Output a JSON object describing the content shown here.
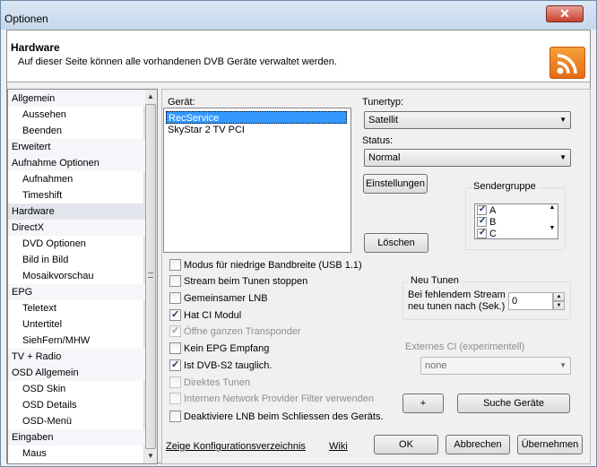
{
  "window": {
    "title": "Optionen",
    "close_label": "✕"
  },
  "header": {
    "title": "Hardware",
    "description": "Auf dieser Seite können alle vorhandenen DVB Geräte verwaltet werden."
  },
  "tree": {
    "items": [
      {
        "label": "Allgemein",
        "level": 0
      },
      {
        "label": "Aussehen",
        "level": 1
      },
      {
        "label": "Beenden",
        "level": 1
      },
      {
        "label": "Erweitert",
        "level": 0
      },
      {
        "label": "Aufnahme Optionen",
        "level": 0
      },
      {
        "label": "Aufnahmen",
        "level": 1
      },
      {
        "label": "Timeshift",
        "level": 1
      },
      {
        "label": "Hardware",
        "level": 0,
        "selected": true
      },
      {
        "label": "DirectX",
        "level": 0
      },
      {
        "label": "DVD Optionen",
        "level": 1
      },
      {
        "label": "Bild in Bild",
        "level": 1
      },
      {
        "label": "Mosaikvorschau",
        "level": 1
      },
      {
        "label": "EPG",
        "level": 0
      },
      {
        "label": "Teletext",
        "level": 1
      },
      {
        "label": "Untertitel",
        "level": 1
      },
      {
        "label": "SiehFern/MHW",
        "level": 1
      },
      {
        "label": "TV + Radio",
        "level": 0
      },
      {
        "label": "OSD Allgemein",
        "level": 0
      },
      {
        "label": "OSD Skin",
        "level": 1
      },
      {
        "label": "OSD Details",
        "level": 1
      },
      {
        "label": "OSD-Menü",
        "level": 1
      },
      {
        "label": "Eingaben",
        "level": 0
      },
      {
        "label": "Maus",
        "level": 1
      }
    ]
  },
  "device": {
    "label": "Gerät:",
    "items": [
      "RecService",
      "SkyStar 2 TV PCI"
    ],
    "selected": "RecService"
  },
  "tunertyp": {
    "label": "Tunertyp:",
    "value": "Satellit"
  },
  "status": {
    "label": "Status:",
    "value": "Normal"
  },
  "buttons": {
    "einstellungen": "Einstellungen",
    "loeschen": "Löschen",
    "plus": "+",
    "suche": "Suche Geräte",
    "ok": "OK",
    "abbrechen": "Abbrechen",
    "uebernehmen": "Übernehmen"
  },
  "sendergruppe": {
    "title": "Sendergruppe",
    "items": [
      {
        "label": "A",
        "checked": true
      },
      {
        "label": "B",
        "checked": true
      },
      {
        "label": "C",
        "checked": true
      }
    ]
  },
  "options": [
    {
      "label": "Modus für niedrige Bandbreite (USB 1.1)",
      "checked": false,
      "enabled": true
    },
    {
      "label": "Stream beim Tunen stoppen",
      "checked": false,
      "enabled": true
    },
    {
      "label": "Gemeinsamer LNB",
      "checked": false,
      "enabled": true
    },
    {
      "label": "Hat CI Modul",
      "checked": true,
      "enabled": true
    },
    {
      "label": "Öffne ganzen Transponder",
      "checked": true,
      "enabled": false
    },
    {
      "label": "Kein EPG Empfang",
      "checked": false,
      "enabled": true
    },
    {
      "label": "Ist DVB-S2 tauglich.",
      "checked": true,
      "enabled": true
    },
    {
      "label": "Direktes Tunen",
      "checked": false,
      "enabled": false
    },
    {
      "label": "Internen Network Provider Filter verwenden",
      "checked": false,
      "enabled": false
    },
    {
      "label": "Deaktiviere LNB beim Schliessen des Geräts.",
      "checked": false,
      "enabled": true
    }
  ],
  "neu_tunen": {
    "title": "Neu Tunen",
    "line1": "Bei fehlendem Stream",
    "line2": "neu tunen nach (Sek.)",
    "value": "0"
  },
  "externes_ci": {
    "title": "Externes CI (experimentell)",
    "value": "none"
  },
  "links": {
    "config_dir": "Zeige Konfigurationsverzeichnis",
    "wiki": "Wiki"
  }
}
